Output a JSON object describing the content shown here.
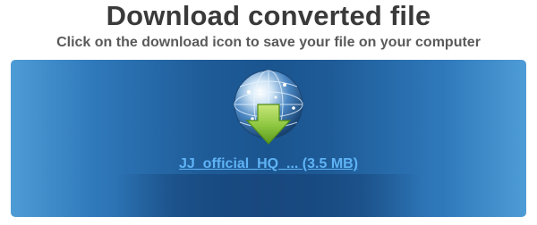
{
  "header": {
    "title": "Download converted file",
    "subtitle": "Click on the download icon to save your file on your computer"
  },
  "download": {
    "icon": "globe-download-arrow-icon",
    "file_name": "JJ_official_HQ_...",
    "file_size": "(3.5 MB)",
    "link_text": "JJ_official_HQ_... (3.5 MB)"
  },
  "colors": {
    "title": "#3a3a3a",
    "subtitle": "#5a5a5a",
    "panel_dark": "#1b5590",
    "panel_light": "#4e9cd6",
    "link": "#5fb3f5",
    "arrow": "#8cc63f"
  }
}
